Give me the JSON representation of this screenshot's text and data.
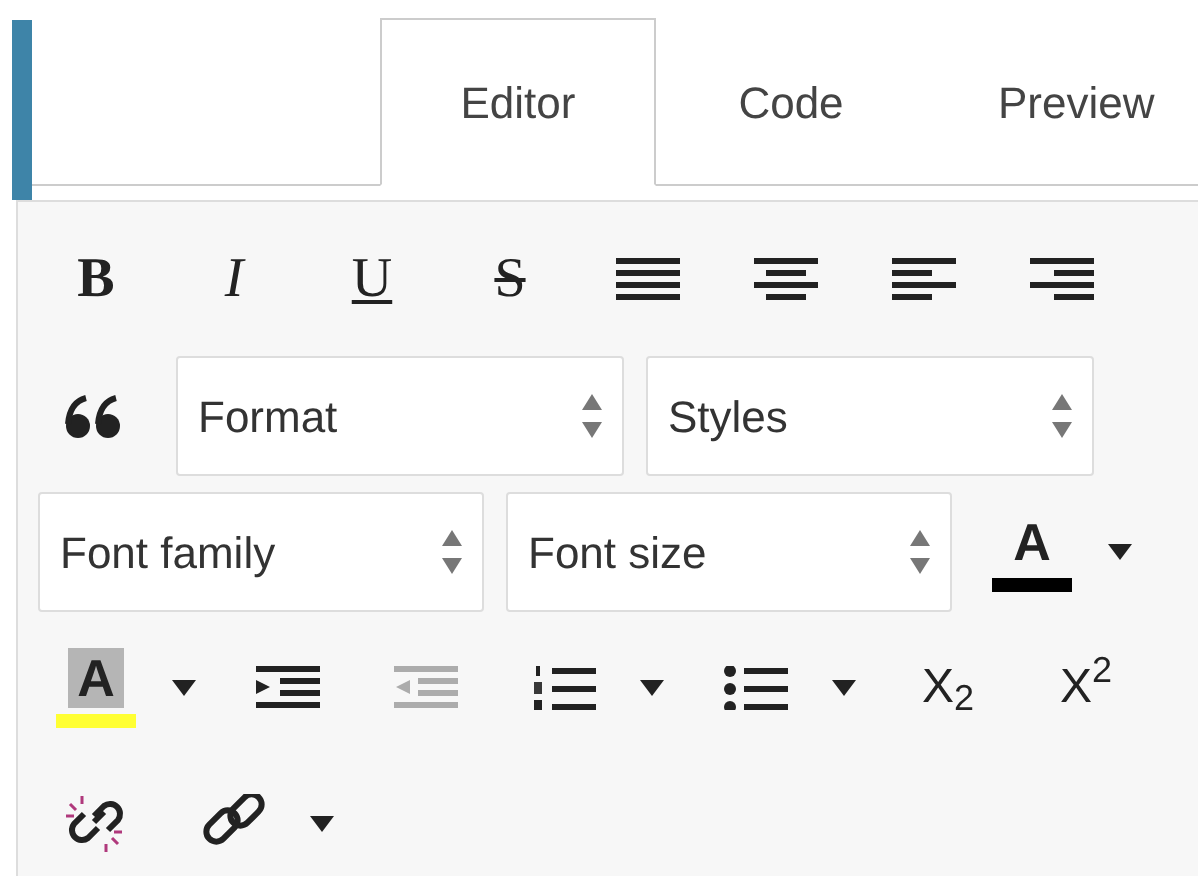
{
  "tabs": [
    {
      "label": "Editor",
      "selected": true
    },
    {
      "label": "Code",
      "selected": false
    },
    {
      "label": "Preview",
      "selected": false
    }
  ],
  "toolbar": [
    [
      {
        "kind": "bold",
        "label": "B",
        "disabled": false
      },
      {
        "kind": "italic",
        "label": "I",
        "disabled": false
      },
      {
        "kind": "underline",
        "label": "U",
        "disabled": false
      },
      {
        "kind": "strike",
        "label": "S",
        "disabled": false
      },
      {
        "kind": "align-justify",
        "disabled": false
      },
      {
        "kind": "align-center",
        "disabled": false
      },
      {
        "kind": "align-left",
        "disabled": false
      },
      {
        "kind": "align-right",
        "disabled": false
      }
    ],
    [
      {
        "kind": "quote",
        "disabled": false
      },
      {
        "kind": "select",
        "label": "Format",
        "disabled": false
      },
      {
        "kind": "select",
        "label": "Styles",
        "disabled": false
      }
    ],
    [
      {
        "kind": "select",
        "label": "Font family",
        "disabled": false
      },
      {
        "kind": "select",
        "label": "Font size",
        "disabled": false
      },
      {
        "kind": "text-color",
        "label": "A",
        "color": "#000000",
        "disabled": false
      },
      {
        "kind": "caret",
        "disabled": false
      }
    ],
    [
      {
        "kind": "highlight",
        "label": "A",
        "color": "#ffff33",
        "disabled": false
      },
      {
        "kind": "caret",
        "disabled": false
      },
      {
        "kind": "indent",
        "disabled": false
      },
      {
        "kind": "outdent",
        "disabled": true
      },
      {
        "kind": "ordered-list",
        "disabled": false
      },
      {
        "kind": "caret",
        "disabled": false
      },
      {
        "kind": "bullet-list",
        "disabled": false
      },
      {
        "kind": "caret",
        "disabled": false
      },
      {
        "kind": "script",
        "label": "X$_{2}$",
        "disabled": false
      },
      {
        "kind": "script",
        "label": "X$^{2}$",
        "disabled": false
      }
    ],
    [
      {
        "kind": "unlink",
        "disabled": false
      },
      {
        "kind": "link",
        "disabled": false
      },
      {
        "kind": "caret",
        "disabled": false
      }
    ]
  ]
}
